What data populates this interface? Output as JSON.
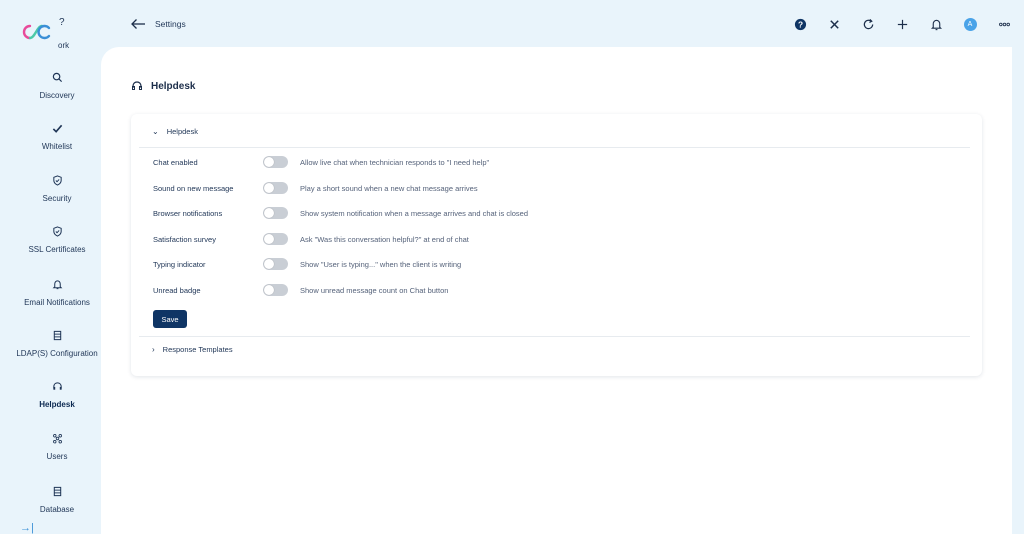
{
  "sidebar": {
    "partial_label": "ork",
    "items": [
      {
        "label": "Discovery",
        "icon": "search-icon"
      },
      {
        "label": "Whitelist",
        "icon": "check-icon"
      },
      {
        "label": "Security",
        "icon": "shield-icon"
      },
      {
        "label": "SSL Certificates",
        "icon": "shield-check-icon"
      },
      {
        "label": "Email Notifications",
        "icon": "bell-icon"
      },
      {
        "label": "LDAP(S) Configuration",
        "icon": "server-icon"
      },
      {
        "label": "Helpdesk",
        "icon": "headset-icon"
      },
      {
        "label": "Users",
        "icon": "users-icon"
      },
      {
        "label": "Database",
        "icon": "database-icon"
      }
    ],
    "active": "Helpdesk"
  },
  "topbar": {
    "breadcrumb": "Settings",
    "avatar_initial": "A"
  },
  "page": {
    "title": "Helpdesk"
  },
  "helpdesk_section": {
    "title": "Helpdesk",
    "expanded": true,
    "settings": [
      {
        "label": "Chat enabled",
        "description": "Allow live chat when technician responds to \"I need help\"",
        "enabled": false
      },
      {
        "label": "Sound on new message",
        "description": "Play a short sound when a new chat message arrives",
        "enabled": false
      },
      {
        "label": "Browser notifications",
        "description": "Show system notification when a message arrives and chat is closed",
        "enabled": false
      },
      {
        "label": "Satisfaction survey",
        "description": "Ask \"Was this conversation helpful?\" at end of chat",
        "enabled": false
      },
      {
        "label": "Typing indicator",
        "description": "Show \"User is typing...\" when the client is writing",
        "enabled": false
      },
      {
        "label": "Unread badge",
        "description": "Show unread message count on Chat button",
        "enabled": false
      }
    ],
    "save_label": "Save"
  },
  "templates_section": {
    "title": "Response Templates",
    "expanded": false
  },
  "colors": {
    "background": "#e9f4fb",
    "primary": "#0f3565",
    "toggle_off": "#c9ced5",
    "avatar": "#4aa3e8"
  }
}
